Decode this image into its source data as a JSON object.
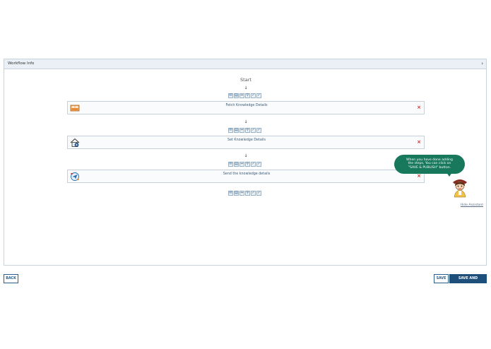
{
  "panel": {
    "title": "Workflow Info",
    "chevron_glyph": "›"
  },
  "workflow": {
    "start_label": "Start",
    "arrow_glyph": "↓",
    "remove_glyph": "×",
    "toolbar_glyphs": [
      "✉",
      "▤",
      "↔",
      "⚲",
      "✓",
      "✓"
    ],
    "steps": [
      {
        "label": "Fetch Knowledge Details",
        "icon": "database-icon"
      },
      {
        "label": "Set Knowledge Details",
        "icon": "house-settings-icon"
      },
      {
        "label": "Send the knowledge details",
        "icon": "send-icon"
      }
    ]
  },
  "assistant": {
    "hide_label": "Hide Assistant",
    "message_line1": "When you have done adding",
    "message_line2": "the steps, You can click on",
    "message_line3": "\"SAVE & PUBLISH\" button.",
    "bubble_color": "#17785b"
  },
  "footer": {
    "back_label": "BACK",
    "save_label": "SAVE",
    "publish_label": "SAVE AND PUBLISH"
  },
  "colors": {
    "accent": "#1e4f7a",
    "remove": "#d62b2b"
  }
}
